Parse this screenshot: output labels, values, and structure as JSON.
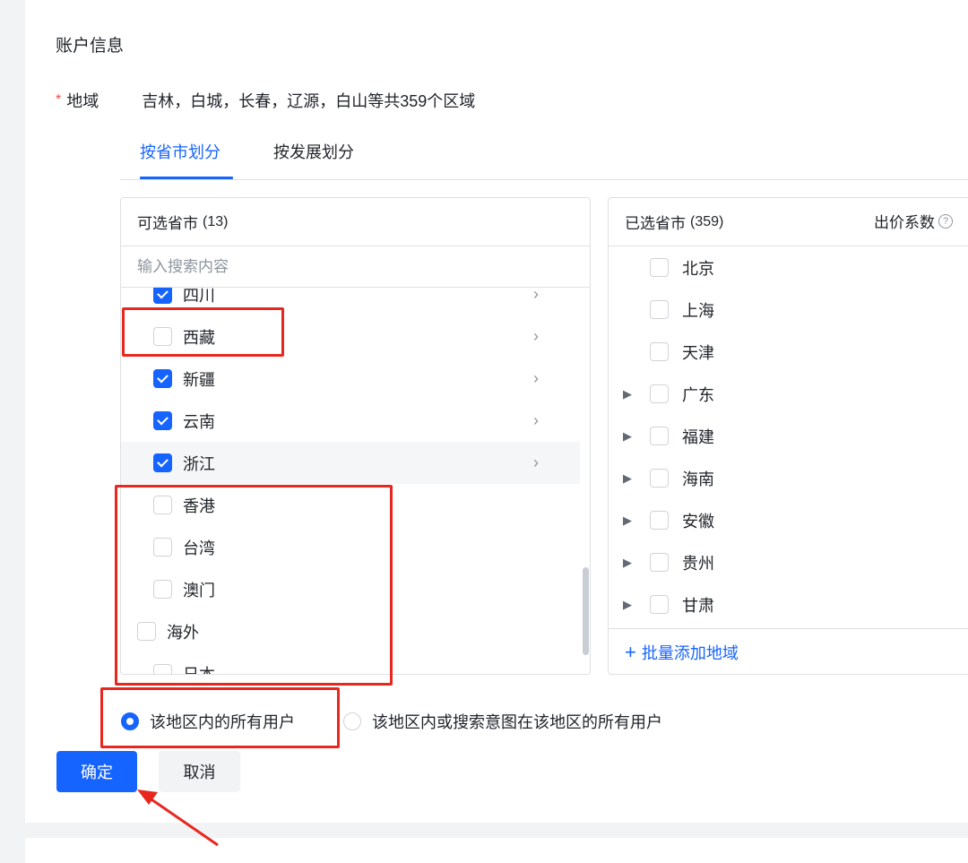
{
  "section": {
    "title": "账户信息"
  },
  "region": {
    "required_mark": "*",
    "label": "地域",
    "summary": "吉林，白城，长春，辽源，白山等共359个区域"
  },
  "tabs": [
    {
      "label": "按省市划分",
      "active": true
    },
    {
      "label": "按发展划分",
      "active": false
    }
  ],
  "left_panel": {
    "title": "可选省市",
    "count": "(13)",
    "search_placeholder": "输入搜索内容",
    "items": [
      {
        "label": "四川",
        "checked": true,
        "chevron": true,
        "indent": 1
      },
      {
        "label": "西藏",
        "checked": false,
        "chevron": true,
        "indent": 1
      },
      {
        "label": "新疆",
        "checked": true,
        "chevron": true,
        "indent": 1
      },
      {
        "label": "云南",
        "checked": true,
        "chevron": true,
        "indent": 1
      },
      {
        "label": "浙江",
        "checked": true,
        "chevron": true,
        "indent": 1,
        "hover": true
      },
      {
        "label": "香港",
        "checked": false,
        "chevron": false,
        "indent": 1
      },
      {
        "label": "台湾",
        "checked": false,
        "chevron": false,
        "indent": 1
      },
      {
        "label": "澳门",
        "checked": false,
        "chevron": false,
        "indent": 1
      },
      {
        "label": "海外",
        "checked": false,
        "chevron": false,
        "indent": 0
      },
      {
        "label": "日本",
        "checked": false,
        "chevron": false,
        "indent": 1
      }
    ]
  },
  "right_panel": {
    "title": "已选省市",
    "count": "(359)",
    "column_label": "出价系数",
    "help_glyph": "?",
    "items": [
      {
        "label": "北京",
        "expandable": false
      },
      {
        "label": "上海",
        "expandable": false
      },
      {
        "label": "天津",
        "expandable": false
      },
      {
        "label": "广东",
        "expandable": true
      },
      {
        "label": "福建",
        "expandable": true
      },
      {
        "label": "海南",
        "expandable": true
      },
      {
        "label": "安徽",
        "expandable": true
      },
      {
        "label": "贵州",
        "expandable": true
      },
      {
        "label": "甘肃",
        "expandable": true
      }
    ],
    "batch_add_label": "批量添加地域",
    "batch_add_icon": "plus-icon"
  },
  "targeting": {
    "options": [
      {
        "label": "该地区内的所有用户",
        "selected": true
      },
      {
        "label": "该地区内或搜索意图在该地区的所有用户",
        "selected": false
      }
    ]
  },
  "actions": {
    "confirm_label": "确定",
    "cancel_label": "取消"
  },
  "colors": {
    "accent": "#1664ff",
    "annotation": "#e8271f",
    "required": "#f54a45"
  }
}
